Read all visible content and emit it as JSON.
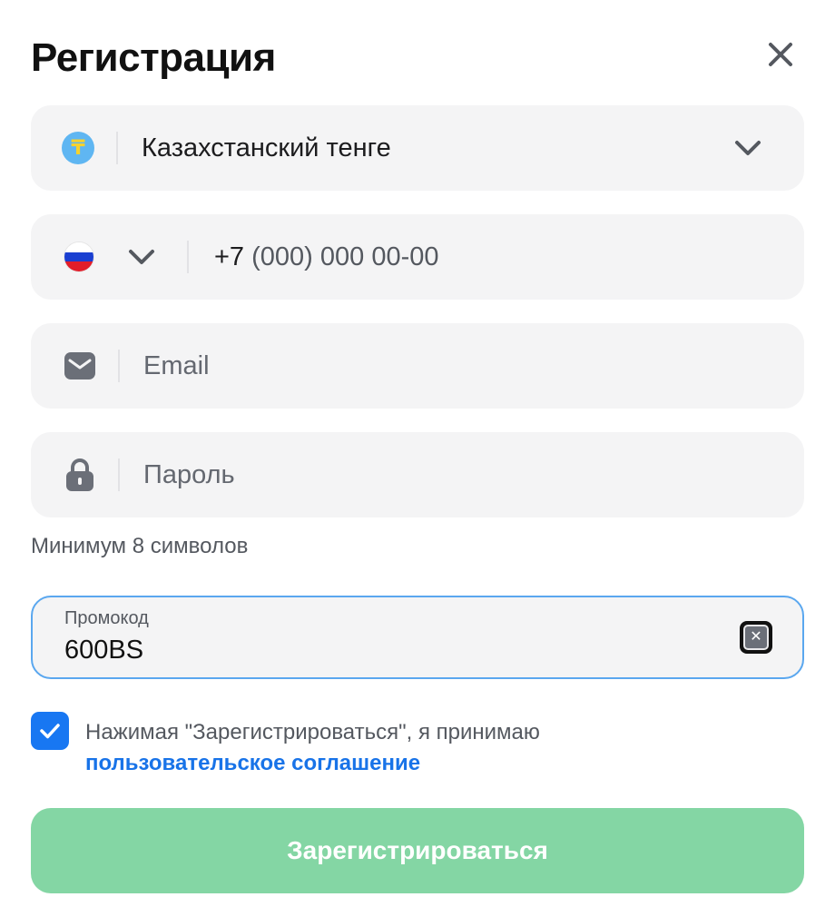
{
  "modal": {
    "title": "Регистрация"
  },
  "currency": {
    "icon": "tenge-coin-icon",
    "symbol": "₸",
    "value": "Казахстанский тенге"
  },
  "phone": {
    "country_flag": "russia-flag-icon",
    "prefix": "+7",
    "mask": "(000) 000 00-00"
  },
  "email": {
    "icon": "envelope-icon",
    "placeholder": "Email"
  },
  "password": {
    "icon": "lock-icon",
    "placeholder": "Пароль",
    "hint": "Минимум 8 символов"
  },
  "promo": {
    "label": "Промокод",
    "value": "600BS"
  },
  "agreement": {
    "checked": true,
    "text": "Нажимая \"Зарегистрироваться\", я принимаю",
    "link_text": "пользовательское соглашение"
  },
  "submit": {
    "label": "Зарегистрироваться"
  },
  "colors": {
    "accent_blue": "#1877f2",
    "submit_green": "#84d6a4",
    "field_bg": "#f4f4f5",
    "promo_border": "#5aa7ef"
  }
}
